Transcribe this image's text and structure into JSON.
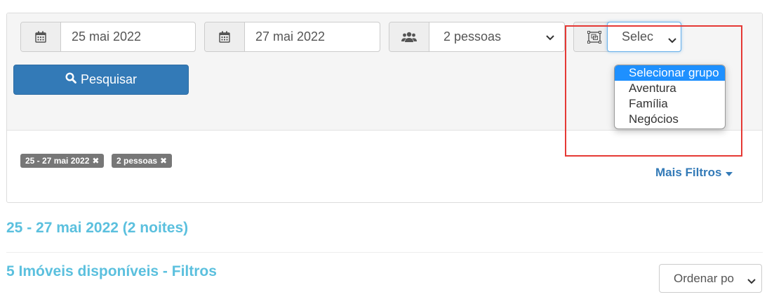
{
  "search_form": {
    "checkin": {
      "icon": "calendar-icon",
      "value": "25 mai 2022"
    },
    "checkout": {
      "icon": "calendar-icon",
      "value": "27 mai 2022"
    },
    "guests": {
      "icon": "users-icon",
      "value": "2 pessoas"
    },
    "group": {
      "icon": "group-select-icon",
      "value": "Selec",
      "options": [
        "Selecionar grupo",
        "Aventura",
        "Família",
        "Negócios"
      ],
      "highlighted_option": "Selecionar grupo"
    },
    "search_button": {
      "icon": "search-icon",
      "label": "Pesquisar"
    }
  },
  "active_filters": [
    {
      "label": "25 - 27 mai 2022"
    },
    {
      "label": "2 pessoas"
    }
  ],
  "more_filters_label": "Mais Filtros",
  "results": {
    "dates_heading": "25 - 27 mai 2022 (2 noites)",
    "count_heading": "5 Imóveis disponíveis - Filtros",
    "sort_value": "Ordenar po"
  },
  "colors": {
    "primary": "#337ab7",
    "heading": "#5bc0de",
    "tag": "#777777",
    "highlight_border": "#e53935",
    "option_selected": "#1e90ff"
  }
}
